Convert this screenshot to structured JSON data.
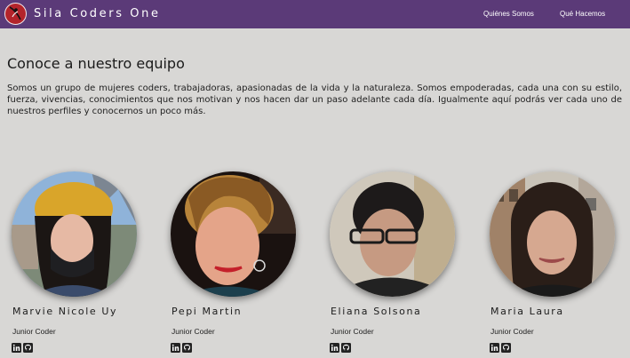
{
  "nav": {
    "brand": "Sila Coders One",
    "links": [
      "Quiénes Somos",
      "Qué Hacemos"
    ]
  },
  "section": {
    "title": "Conoce a nuestro equipo",
    "intro": "Somos un grupo de mujeres coders, trabajadoras, apasionadas de la vida y la naturaleza. Somos empoderadas, cada una con su estilo, fuerza, vivencias, conocimientos que nos motivan y nos hacen dar un paso adelante cada día. Igualmente aquí podrás ver cada uno de nuestros perfiles y conocernos un poco más."
  },
  "members": [
    {
      "name": "Marvie Nicole Uy",
      "role": "Junior Coder",
      "icons": [
        "linkedin-icon",
        "github-icon"
      ]
    },
    {
      "name": "Pepi Martin",
      "role": "Junior Coder",
      "icons": [
        "linkedin-icon",
        "github-icon"
      ]
    },
    {
      "name": "Eliana Solsona",
      "role": "Junior Coder",
      "icons": [
        "linkedin-icon",
        "github-icon"
      ]
    },
    {
      "name": "Maria Laura",
      "role": "Junior Coder",
      "icons": [
        "linkedin-icon",
        "github-icon"
      ]
    }
  ],
  "colors": {
    "navbar": "#5b3a78",
    "background": "#d8d7d5",
    "logo": "#b3242b"
  }
}
